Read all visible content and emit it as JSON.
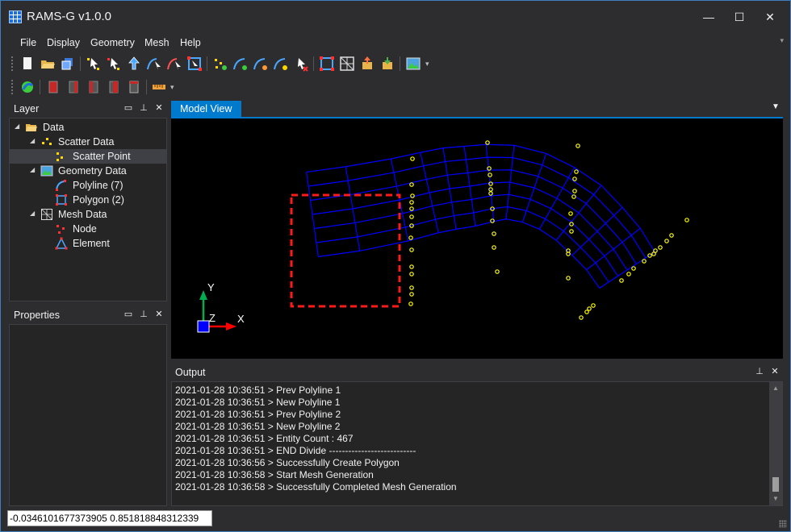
{
  "window": {
    "title": "RAMS-G v1.0.0",
    "minimize_glyph": "—",
    "maximize_glyph": "☐",
    "close_glyph": "✕"
  },
  "menu": {
    "items": [
      "File",
      "Display",
      "Geometry",
      "Mesh",
      "Help"
    ],
    "overflow_glyph": "▾"
  },
  "toolbar": {
    "row1_icons": [
      "new-file-icon",
      "open-folder-icon",
      "save-icon",
      "select-point-icon",
      "deselect-point-icon",
      "move-point-icon",
      "select-polyline-icon",
      "deselect-polyline-icon",
      "select-polygon-icon",
      "add-point-icon",
      "add-polyline-icon",
      "edit-polyline-icon",
      "split-polyline-icon",
      "delete-icon",
      "polygon-icon",
      "mesh-grid-icon",
      "import-icon",
      "export-icon",
      "display-image-icon"
    ],
    "row2_icons": [
      "refresh-icon",
      "box-front-icon",
      "box-back-icon",
      "box-left-icon",
      "box-right-icon",
      "box-top-icon",
      "ruler-icon"
    ],
    "dropdown_glyph": "▾"
  },
  "layer_panel": {
    "title": "Layer",
    "tree": [
      {
        "label": "Data",
        "icon": "folder-icon",
        "expanded": true
      },
      {
        "label": "Scatter Data",
        "icon": "scatter-data-icon",
        "expanded": true
      },
      {
        "label": "Scatter Point",
        "icon": "scatter-point-icon",
        "selected": true
      },
      {
        "label": "Geometry Data",
        "icon": "geometry-data-icon",
        "expanded": true
      },
      {
        "label": "Polyline (7)",
        "icon": "polyline-icon"
      },
      {
        "label": "Polygon (2)",
        "icon": "polygon-icon"
      },
      {
        "label": "Mesh Data",
        "icon": "mesh-data-icon",
        "expanded": true
      },
      {
        "label": "Node",
        "icon": "node-icon"
      },
      {
        "label": "Element",
        "icon": "element-icon"
      }
    ]
  },
  "properties_panel": {
    "title": "Properties"
  },
  "panel_buttons": {
    "window": "▭",
    "pin": "⊥",
    "close": "✕"
  },
  "model_view": {
    "tab_label": "Model View",
    "dropdown_glyph": "▼",
    "axis_labels": {
      "x": "X",
      "y": "Y",
      "z": "Z"
    },
    "colors": {
      "mesh": "#0000ff",
      "scatter": "#ffff00",
      "selection": "#ff0000",
      "x_axis": "#ff0000",
      "y_axis": "#00b050",
      "z_axis": "#0000ff"
    }
  },
  "output_panel": {
    "title": "Output",
    "lines": [
      "2021-01-28 10:36:51 > Prev Polyline 1",
      "2021-01-28 10:36:51 > New Polyline 1",
      "2021-01-28 10:36:51 > Prev Polyline 2",
      "2021-01-28 10:36:51 > New Polyline 2",
      "2021-01-28 10:36:51 > Entity Count : 467",
      "2021-01-28 10:36:51 > END Divide ---------------------------",
      "2021-01-28 10:36:56 > Successfully Create Polygon",
      "2021-01-28 10:36:58 > Start Mesh Generation",
      "2021-01-28 10:36:58 > Successfully Completed Mesh Generation"
    ],
    "scroll_up_glyph": "▲",
    "scroll_down_glyph": "▼"
  },
  "status_bar": {
    "coordinates": "-0.0346101677373905 0.851818848312339"
  }
}
